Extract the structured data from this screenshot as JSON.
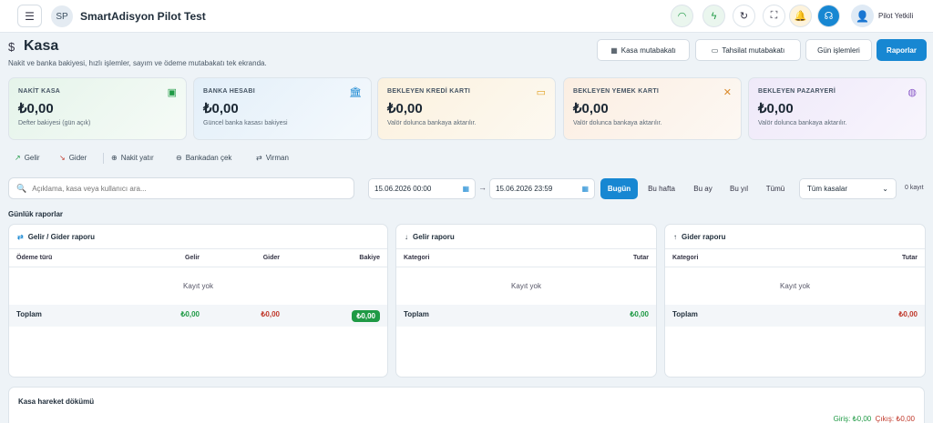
{
  "app": {
    "title": "SmartAdisyon Pilot Test",
    "avatar_initials": "SP",
    "user_name": "Pilot Yetkili"
  },
  "topbar_icons": [
    {
      "name": "wifi-icon",
      "glyph": "◠",
      "color": "#1f9a45",
      "bg": "#eaf6ee"
    },
    {
      "name": "bolt-icon",
      "glyph": "ϟ",
      "color": "#1f9a45",
      "bg": "#eaf6ee"
    },
    {
      "name": "refresh-icon",
      "glyph": "↻",
      "color": "#334",
      "bg": "#fff"
    },
    {
      "name": "fullscreen-icon",
      "glyph": "⛶",
      "color": "#334",
      "bg": "#fff"
    },
    {
      "name": "bell-icon",
      "glyph": "🔔",
      "color": "#d49a1a",
      "bg": "#fdf3dc"
    },
    {
      "name": "headset-icon",
      "glyph": "☊",
      "color": "#fff",
      "bg": "#1787d2"
    }
  ],
  "page": {
    "icon": "$",
    "title": "Kasa",
    "subtitle": "Nakit ve banka bakiyesi, hızlı işlemler, sayım ve ödeme mutabakatı tek ekranda."
  },
  "header_buttons": {
    "kasa_mutabakati": "Kasa mutabakatı",
    "tahsilat_mutabakati": "Tahsilat mutabakatı",
    "gun_islemleri": "Gün işlemleri",
    "raporlar": "Raporlar"
  },
  "cards": [
    {
      "title": "NAKİT KASA",
      "value": "₺0,00",
      "desc": "Defter bakiyesi (gün açık)",
      "icon": "▣",
      "icon_color": "#1f9a45",
      "bg": "linear-gradient(135deg,#e5f4ea,#f6fbf7)"
    },
    {
      "title": "BANKA HESABI",
      "value": "₺0,00",
      "desc": "Güncel banka kasası bakiyesi",
      "icon": "🏛",
      "icon_color": "#1787d2",
      "bg": "linear-gradient(135deg,#e3eff9,#f4f9fd)"
    },
    {
      "title": "BEKLEYEN KREDİ KARTI",
      "value": "₺0,00",
      "desc": "Valör dolunca bankaya aktarılır.",
      "icon": "▭",
      "icon_color": "#e0a020",
      "bg": "linear-gradient(135deg,#fbf1de,#fdf9f1)"
    },
    {
      "title": "BEKLEYEN YEMEK KARTI",
      "value": "₺0,00",
      "desc": "Valör dolunca bankaya aktarılır.",
      "icon": "✕",
      "icon_color": "#d98a2b",
      "bg": "linear-gradient(135deg,#fbeee2,#fdf8f3)"
    },
    {
      "title": "BEKLEYEN PAZARYERİ",
      "value": "₺0,00",
      "desc": "Valör dolunca bankaya aktarılır.",
      "icon": "◍",
      "icon_color": "#8c5cc9",
      "bg": "linear-gradient(135deg,#efe9f9,#f8f5fd)"
    }
  ],
  "actions": {
    "gelir": "Gelir",
    "gider": "Gider",
    "nakit_yatir": "Nakit yatır",
    "bankadan_cek": "Bankadan çek",
    "virman": "Virman"
  },
  "filters": {
    "search_placeholder": "Açıklama, kasa veya kullanıcı ara...",
    "date_from": "15.06.2026 00:00",
    "date_to": "15.06.2026 23:59",
    "ranges": [
      "Bugün",
      "Bu hafta",
      "Bu ay",
      "Bu yıl",
      "Tümü"
    ],
    "kasa_select": "Tüm kasalar",
    "count": "0 kayıt"
  },
  "section_title": "Günlük raporlar",
  "panels": {
    "gelir_gider": {
      "title": "Gelir / Gider raporu",
      "cols": [
        "Ödeme türü",
        "Gelir",
        "Gider",
        "Bakiye"
      ],
      "empty": "Kayıt yok",
      "total_label": "Toplam",
      "gelir": "₺0,00",
      "gider": "₺0,00",
      "bakiye": "₺0,00"
    },
    "gelir": {
      "title": "Gelir raporu",
      "cols": [
        "Kategori",
        "Tutar"
      ],
      "empty": "Kayıt yok",
      "total_label": "Toplam",
      "total": "₺0,00"
    },
    "gider": {
      "title": "Gider raporu",
      "cols": [
        "Kategori",
        "Tutar"
      ],
      "empty": "Kayıt yok",
      "total_label": "Toplam",
      "total": "₺0,00"
    }
  },
  "dokum": {
    "title": "Kasa hareket dökümü",
    "giris": "Giriş: ₺0,00",
    "cikis": "Çıkış: ₺0,00"
  }
}
